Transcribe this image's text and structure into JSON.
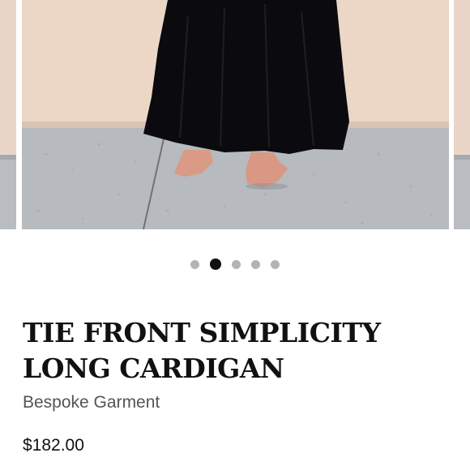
{
  "carousel": {
    "total_images": 5,
    "active_index": 1,
    "image_subject": "product-photo-black-skirt-barefoot"
  },
  "product": {
    "title": "TIE FRONT SIMPLICITY LONG CARDIGAN",
    "brand": "Bespoke Garment",
    "price": "$182.00"
  },
  "colors": {
    "active_dot": "#111111",
    "inactive_dot": "#b3b3b3",
    "title_text": "#111111",
    "brand_text": "#555555"
  }
}
